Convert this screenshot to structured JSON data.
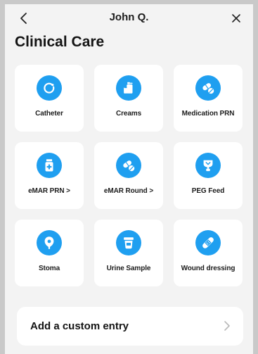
{
  "header": {
    "title": "John Q.",
    "back_icon": "chevron-left-icon",
    "close_icon": "close-icon"
  },
  "page": {
    "title": "Clinical Care"
  },
  "colors": {
    "accent": "#1f9ff0",
    "background": "#f3f3f3",
    "card": "#ffffff"
  },
  "tiles": [
    {
      "label": "Catheter",
      "icon": "catheter-icon"
    },
    {
      "label": "Creams",
      "icon": "cream-tube-icon"
    },
    {
      "label": "Medication PRN",
      "icon": "pills-icon"
    },
    {
      "label": "eMAR PRN >",
      "icon": "medicine-bottle-icon"
    },
    {
      "label": "eMAR Round >",
      "icon": "pills-icon"
    },
    {
      "label": "PEG Feed",
      "icon": "feed-bag-icon"
    },
    {
      "label": "Stoma",
      "icon": "stoma-icon"
    },
    {
      "label": "Urine Sample",
      "icon": "sample-cup-icon"
    },
    {
      "label": "Wound dressing",
      "icon": "bandage-icon"
    }
  ],
  "custom_entry": {
    "label": "Add a custom entry",
    "chevron_icon": "chevron-right-icon"
  }
}
